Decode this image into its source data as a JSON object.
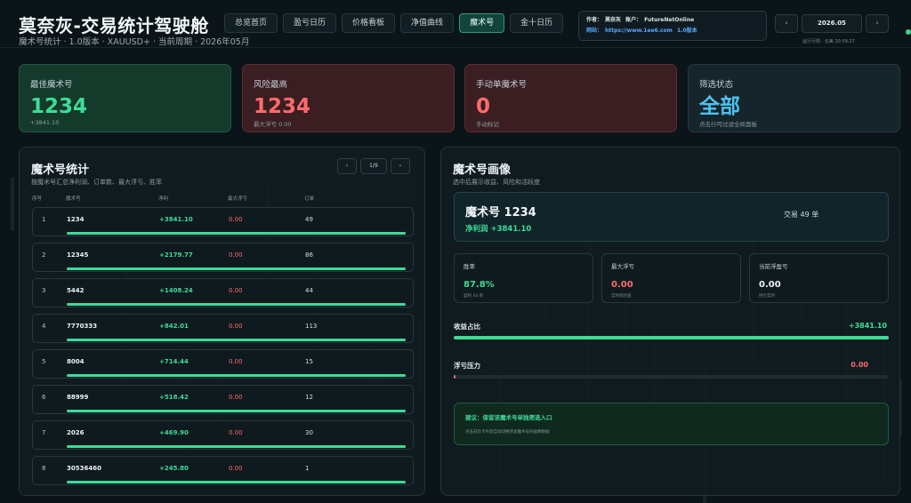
{
  "header": {
    "title": "莫奈灰-交易统计驾驶舱",
    "subtitle": "魔术号统计 · 1.0版本 · XAUUSD+ · 当前周期 · 2026年05月",
    "nav": [
      {
        "label": "总览首页",
        "active": false
      },
      {
        "label": "盈亏日历",
        "active": false
      },
      {
        "label": "价格看板",
        "active": false
      },
      {
        "label": "净值曲线",
        "active": false
      },
      {
        "label": "魔术号",
        "active": true
      },
      {
        "label": "金十日历",
        "active": false
      }
    ],
    "info": {
      "author_label": "作者：",
      "author": "莫奈灰",
      "account_label": "账户：",
      "account": "FutureNetOnline",
      "site_label": "网站：",
      "site": "https://www.1ee6.com",
      "version": "1.0版本"
    },
    "date_prev": "‹",
    "date_value": "2026.05",
    "date_next": "›",
    "update_time": "运行行情 · 北美 20:59:27",
    "status_color": "#39d98a"
  },
  "kpis": [
    {
      "label": "最佳魔术号",
      "value": "1234",
      "sub": "+3841.10"
    },
    {
      "label": "风险最高",
      "value": "1234",
      "sub": "最大浮亏 0.00"
    },
    {
      "label": "手动单魔术号",
      "value": "0",
      "sub": "手动标记"
    },
    {
      "label": "筛选状态",
      "value": "全部",
      "sub": "点击行可过滤全局面板"
    }
  ],
  "stats": {
    "title": "魔术号统计",
    "subtitle": "按魔术号汇总净利润、订单数、最大浮亏、胜率",
    "pager": {
      "prev": "‹",
      "page": "1/9",
      "next": "›"
    },
    "columns": {
      "idx": "序号",
      "magic": "魔术号",
      "profit": "净利",
      "dd": "最大浮亏",
      "orders": "订单"
    },
    "rows": [
      {
        "idx": "1",
        "magic": "1234",
        "profit": "+3841.10",
        "dd": "0.00",
        "orders": "49",
        "share": 1.0
      },
      {
        "idx": "2",
        "magic": "12345",
        "profit": "+2179.77",
        "dd": "0.00",
        "orders": "86",
        "share": 1.0
      },
      {
        "idx": "3",
        "magic": "5442",
        "profit": "+1408.24",
        "dd": "0.00",
        "orders": "44",
        "share": 1.0
      },
      {
        "idx": "4",
        "magic": "7770333",
        "profit": "+842.01",
        "dd": "0.00",
        "orders": "113",
        "share": 1.0
      },
      {
        "idx": "5",
        "magic": "8004",
        "profit": "+714.44",
        "dd": "0.00",
        "orders": "15",
        "share": 1.0
      },
      {
        "idx": "6",
        "magic": "88999",
        "profit": "+518.42",
        "dd": "0.00",
        "orders": "12",
        "share": 1.0
      },
      {
        "idx": "7",
        "magic": "2026",
        "profit": "+469.90",
        "dd": "0.00",
        "orders": "30",
        "share": 1.0
      },
      {
        "idx": "8",
        "magic": "30536460",
        "profit": "+245.80",
        "dd": "0.00",
        "orders": "1",
        "share": 1.0
      }
    ]
  },
  "portrait": {
    "title": "魔术号画像",
    "subtitle": "选中后展示收益、风险和活跃度",
    "card_title": "魔术号 1234",
    "card_profit": "净利润 +3841.10",
    "card_trades": "交易 49 单",
    "metrics": [
      {
        "label": "胜率",
        "value": "87.8%",
        "sub": "盈利 43 单"
      },
      {
        "label": "最大浮亏",
        "value": "0.00",
        "sub": "实时风险值"
      },
      {
        "label": "当前浮盈亏",
        "value": "0.00",
        "sub": "持仓实时"
      }
    ],
    "income_label": "收益占比",
    "income_value": "+3841.10",
    "income_share": 1.0,
    "float_label": "浮亏压力",
    "float_value": "0.00",
    "float_share": 0.004,
    "advice_title": "建议：保留该魔术号单独筛选入口",
    "advice_sub": "点击日历卡片后自动切换到该魔术号的画像数据"
  },
  "colors": {
    "profit": "#3ddc97",
    "loss": "#ff6b6b",
    "accent": "#4cc3f0"
  }
}
